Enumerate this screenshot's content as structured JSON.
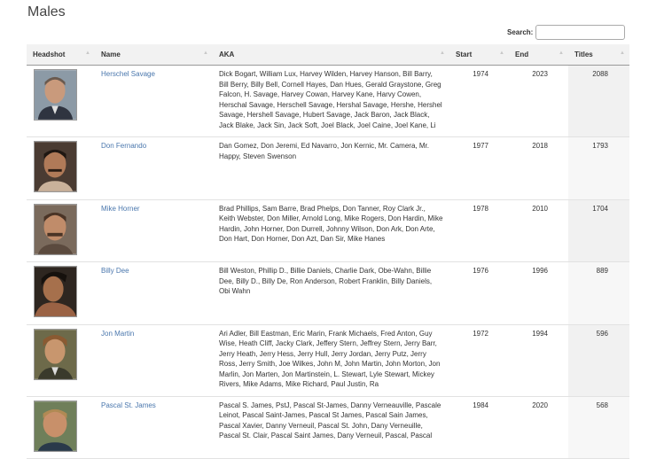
{
  "page": {
    "title": "Males"
  },
  "search": {
    "label": "Search:",
    "value": "",
    "placeholder": ""
  },
  "table": {
    "columns": [
      "Headshot",
      "Name",
      "AKA",
      "Start",
      "End",
      "Titles"
    ],
    "rows": [
      {
        "name": "Herschel Savage",
        "aka": "Dick Bogart, William Lux, Harvey Wilden, Harvey Hanson, Bill Barry, Bill Berry, Billy Bell, Cornell Hayes, Dan Hues, Gerald Graystone, Greg Falcon, H. Savage, Harvey Cowan, Harvey Kane, Harvy Cowen, Herschal Savage, Herschell Savage, Hershal Savage, Hershe, Hershel Savage, Hershell Savage, Hubert Savage, Jack Baron, Jack Black, Jack Blake, Jack Sin, Jack Soft, Joel Black, Joel Caine, Joel Kane, Li",
        "start": "1974",
        "end": "2023",
        "titles": "2088"
      },
      {
        "name": "Don Fernando",
        "aka": "Dan Gomez, Don Jeremi, Ed Navarro, Jon Kernic, Mr. Camera, Mr. Happy, Steven Swenson",
        "start": "1977",
        "end": "2018",
        "titles": "1793"
      },
      {
        "name": "Mike Horner",
        "aka": "Brad Phillips, Sam Barre, Brad Phelps, Don Tanner, Roy Clark Jr., Keith Webster, Don Miller, Arnold Long, Mike Rogers, Don Hardin, Mike Hardin, John Horner, Don Durrell, Johnny Wilson, Don Ark, Don Arte, Don Hart, Don Horner, Don Azt, Dan Sir, Mike Hanes",
        "start": "1978",
        "end": "2010",
        "titles": "1704"
      },
      {
        "name": "Billy Dee",
        "aka": "Bill Weston, Phillip D., Billie Daniels, Charlie Dark, Obe-Wahn, Billie Dee, Billy D., Billy De, Ron Anderson, Robert Franklin, Billy Daniels, Obi Wahn",
        "start": "1976",
        "end": "1996",
        "titles": "889"
      },
      {
        "name": "Jon Martin",
        "aka": "Ari Adler, Bill Eastman, Eric Marin, Frank Michaels, Fred Anton, Guy Wise, Heath Cliff, Jacky Clark, Jeffery Stern, Jeffrey Stern, Jerry Barr, Jerry Heath, Jerry Hess, Jerry Hull, Jerry Jordan, Jerry Putz, Jerry Ross, Jerry Smith, Joe Wilkes, John M, John Martin, John Morton, Jon Marlin, Jon Marten, Jon Martinstein, L. Stewart, Lyle Stewart, Mickey Rivers, Mike Adams, Mike Richard, Paul Justin, Ra",
        "start": "1972",
        "end": "1994",
        "titles": "596"
      },
      {
        "name": "Pascal St. James",
        "aka": "Pascal S. James, PstJ, Pascal St-James, Danny Verneauville, Pascale Leinot, Pascal Saint-James, Pascal St James, Pascal Sain James, Pascal Xavier, Danny Verneuil, Pascal St. John, Dany Verneuille, Pascal St. Clair, Pascal Saint James, Dany Verneuil, Pascal, Pascal",
        "start": "1984",
        "end": "2020",
        "titles": "568"
      }
    ]
  },
  "colors": {
    "link": "#4a77ad",
    "header_bg": "#f2f2f2",
    "sorted_col_bg": "#f1f1f1"
  }
}
